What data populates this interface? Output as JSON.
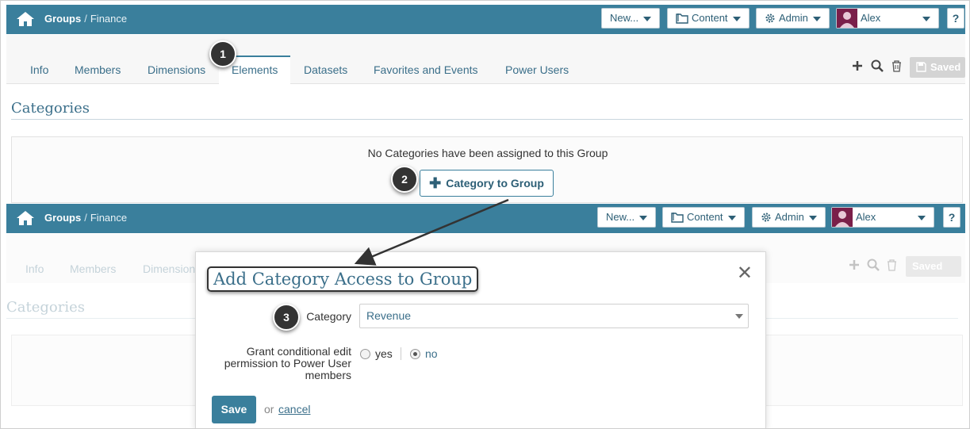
{
  "topbar": {
    "crumb_group": "Groups",
    "crumb_sep": "/",
    "crumb_leaf": "Finance",
    "new_label": "New...",
    "content_label": "Content",
    "admin_label": "Admin",
    "user_name": "Alex",
    "help_label": "?"
  },
  "tabs": [
    {
      "label": "Info"
    },
    {
      "label": "Members"
    },
    {
      "label": "Dimensions"
    },
    {
      "label": "Elements"
    },
    {
      "label": "Datasets"
    },
    {
      "label": "Favorites and Events"
    },
    {
      "label": "Power Users"
    }
  ],
  "toolbar": {
    "saved_label": "Saved"
  },
  "categories": {
    "title": "Categories",
    "empty_message": "No Categories have been assigned to this Group",
    "add_button_label": "Category to Group"
  },
  "callouts": [
    "1",
    "2",
    "3"
  ],
  "modal": {
    "title": "Add Category Access to Group",
    "close": "✕",
    "category_label": "Category",
    "category_value": "Revenue",
    "grant_label_1": "Grant conditional edit",
    "grant_label_2": "permission to Power User",
    "grant_label_3": "members",
    "radio_yes": "yes",
    "radio_no": "no",
    "selected": "no",
    "save_label": "Save",
    "or_text": "or",
    "cancel_label": "cancel"
  },
  "colors": {
    "brand": "#3a7f9c",
    "link": "#3b6f8a",
    "avatar": "#7a1f4a"
  }
}
